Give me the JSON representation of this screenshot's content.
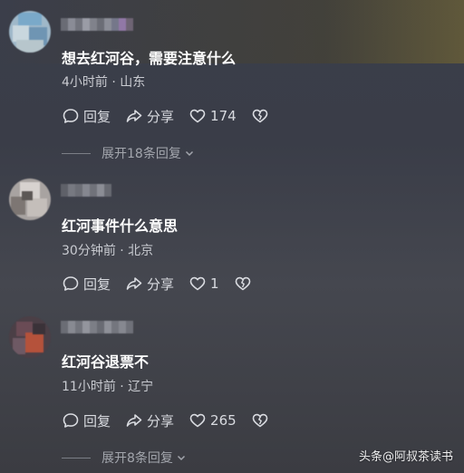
{
  "comments": [
    {
      "text": "想去红河谷，需要注意什么",
      "meta": "4小时前 · 山东",
      "reply_label": "回复",
      "share_label": "分享",
      "like_count": "174",
      "expand_label": "展开18条回复"
    },
    {
      "text": "红河事件什么意思",
      "meta": "30分钟前 · 北京",
      "reply_label": "回复",
      "share_label": "分享",
      "like_count": "1"
    },
    {
      "text": "红河谷退票不",
      "meta": "11小时前 · 辽宁",
      "reply_label": "回复",
      "share_label": "分享",
      "like_count": "265",
      "expand_label": "展开8条回复"
    }
  ],
  "watermark": "头条@阿叔茶读书",
  "icons": [
    "comment-icon",
    "share-icon",
    "heart-icon",
    "broken-heart-icon",
    "chevron-down-icon"
  ],
  "colors": {
    "text": "#ffffff",
    "meta": "#c9cbd1",
    "muted": "#a3a6ad"
  }
}
